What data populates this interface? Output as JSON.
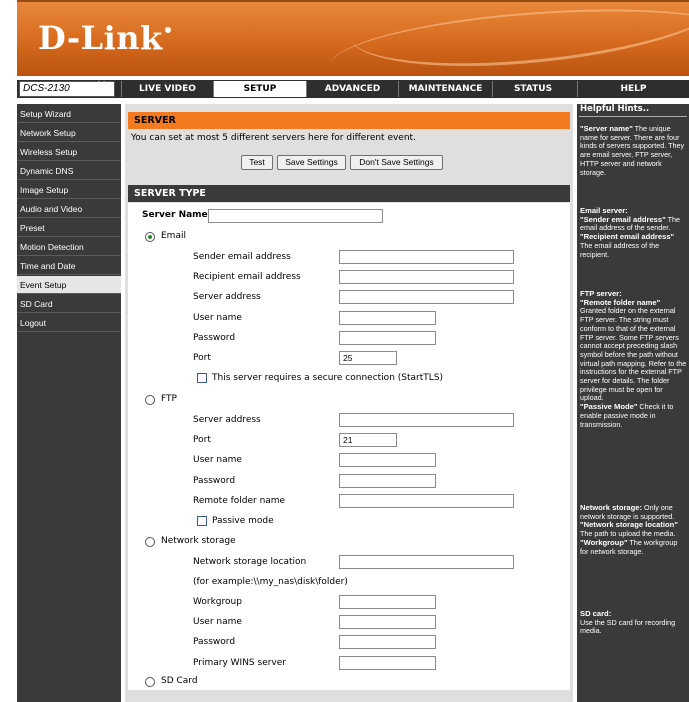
{
  "header": {
    "logo": "D-Link"
  },
  "model": "DCS-2130",
  "tabs": [
    "LIVE VIDEO",
    "SETUP",
    "ADVANCED",
    "MAINTENANCE",
    "STATUS",
    "HELP"
  ],
  "active_tab": "SETUP",
  "sidebar": {
    "items": [
      "Setup Wizard",
      "Network Setup",
      "Wireless Setup",
      "Dynamic DNS",
      "Image Setup",
      "Audio and Video",
      "Preset",
      "Motion Detection",
      "Time and Date",
      "Event Setup",
      "SD Card",
      "Logout"
    ],
    "active": "Event Setup"
  },
  "server": {
    "title": "SERVER",
    "desc": "You can set at most 5 different servers here for different event.",
    "test_label": "Test",
    "save_label": "Save Settings",
    "dont_save_label": "Don't Save Settings"
  },
  "server_type": {
    "title": "SERVER TYPE",
    "server_name_label": "Server Name:",
    "server_name_value": "",
    "email": {
      "label": "Email",
      "selected": true,
      "sender_label": "Sender email address",
      "recipient_label": "Recipient email address",
      "server_address_label": "Server address",
      "user_label": "User name",
      "password_label": "Password",
      "port_label": "Port",
      "port_value": "25",
      "starttls_label": "This server requires a secure connection (StartTLS)"
    },
    "ftp": {
      "label": "FTP",
      "server_address_label": "Server address",
      "port_label": "Port",
      "port_value": "21",
      "user_label": "User name",
      "password_label": "Password",
      "remote_folder_label": "Remote folder name",
      "passive_label": "Passive mode"
    },
    "network_storage": {
      "label": "Network storage",
      "location_label": "Network storage location",
      "example": "(for example:\\\\my_nas\\disk\\folder)",
      "workgroup_label": "Workgroup",
      "user_label": "User name",
      "password_label": "Password",
      "wins_label": "Primary WINS server"
    },
    "sd_card": {
      "label": "SD Card"
    }
  },
  "help": {
    "title": "Helpful Hints..",
    "server_name_title": "\"Server name\"",
    "server_name_text": " The unique name for server. There are four kinds of servers supported. They are email server, FTP server, HTTP server and network storage.",
    "email_title": "Email server:",
    "sender_title": "\"Sender email address\"",
    "sender_text": " The email address of the sender.",
    "recipient_title": "\"Recipient email address\"",
    "recipient_text": " The email address of the recipient.",
    "ftp_title": "FTP server:",
    "remote_title": "\"Remote folder name\"",
    "remote_text": " Granted folder on the external FTP server. The string must conform to that of the external FTP server. Some FTP servers cannot accept preceding slash symbol before the path without virtual path mapping. Refer to the instructions for the external FTP server for details. The folder privilege must be open for upload.",
    "passive_title": "\"Passive Mode\"",
    "passive_text": " Check it to enable passive mode in transmission.",
    "ns_title": "Network storage:",
    "ns_text": " Only one network storage is supported.",
    "ns_loc_title": "\"Network storage location\"",
    "ns_loc_text": " The path to upload the media.",
    "workgroup_title": "\"Workgroup\"",
    "workgroup_text": " The workgroup for network storage.",
    "sd_title": "SD card:",
    "sd_text": "Use the SD card for recording media."
  }
}
